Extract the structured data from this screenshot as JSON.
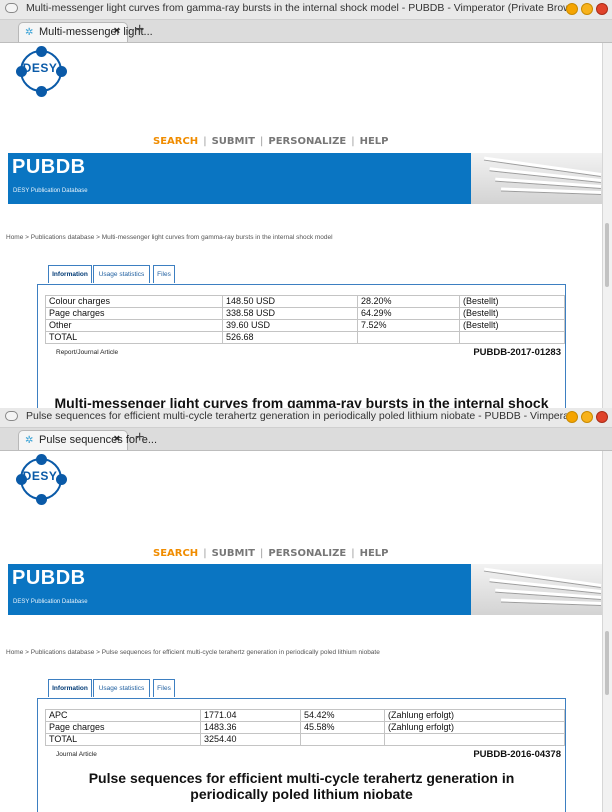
{
  "windows": [
    {
      "window_title": "Multi-messenger light curves from gamma-ray bursts in the internal shock model - PUBDB - Vimperator (Private Browsing)",
      "tab_label": "Multi-messenger light...",
      "tab_close": "×",
      "new_tab": "+",
      "logo_text": "DESY",
      "nav": {
        "search": "SEARCH",
        "submit": "SUBMIT",
        "personalize": "PERSONALIZE",
        "help": "HELP",
        "sep": "|"
      },
      "banner": {
        "title": "PUBDB",
        "subtitle": "DESY Publication Database"
      },
      "breadcrumb": "Home > Publications database > Multi-messenger light curves from gamma-ray bursts in the internal shock model",
      "tabs": {
        "information": "Information",
        "usage": "Usage statistics",
        "files": "Files"
      },
      "fees": [
        [
          "Colour charges",
          "148.50 USD",
          "28.20%",
          "(Bestellt)"
        ],
        [
          "Page charges",
          "338.58 USD",
          "64.29%",
          "(Bestellt)"
        ],
        [
          "Other",
          "39.60 USD",
          "7.52%",
          "(Bestellt)"
        ],
        [
          "TOTAL",
          "526.68",
          "",
          ""
        ]
      ],
      "doc_type": "Report/Journal Article",
      "doc_id": "PUBDB-2017-01283",
      "article_title": "Multi-messenger light curves from gamma-ray bursts in the internal shock model"
    },
    {
      "window_title": "Pulse sequences for efficient multi-cycle terahertz generation in periodically poled lithium niobate - PUBDB - Vimperator (Private Browsing)",
      "tab_label": "Pulse sequences for e...",
      "tab_close": "×",
      "new_tab": "+",
      "logo_text": "DESY",
      "nav": {
        "search": "SEARCH",
        "submit": "SUBMIT",
        "personalize": "PERSONALIZE",
        "help": "HELP",
        "sep": "|"
      },
      "banner": {
        "title": "PUBDB",
        "subtitle": "DESY Publication Database"
      },
      "breadcrumb": "Home > Publications database > Pulse sequences for efficient multi-cycle terahertz generation in periodically poled lithium niobate",
      "tabs": {
        "information": "Information",
        "usage": "Usage statistics",
        "files": "Files"
      },
      "fees": [
        [
          "APC",
          "1771.04",
          "54.42%",
          "(Zahlung erfolgt)"
        ],
        [
          "Page charges",
          "1483.36",
          "45.58%",
          "(Zahlung erfolgt)"
        ],
        [
          "TOTAL",
          "3254.40",
          "",
          ""
        ]
      ],
      "doc_type": "Journal Article",
      "doc_id": "PUBDB-2016-04378",
      "article_title": "Pulse sequences for efficient multi-cycle terahertz generation in periodically poled lithium niobate"
    }
  ],
  "colors": {
    "nav_active": "#f08c00",
    "banner_blue": "#0a75c2",
    "desy_blue": "#0a5aa8",
    "tab_border": "#3d7fc1"
  }
}
